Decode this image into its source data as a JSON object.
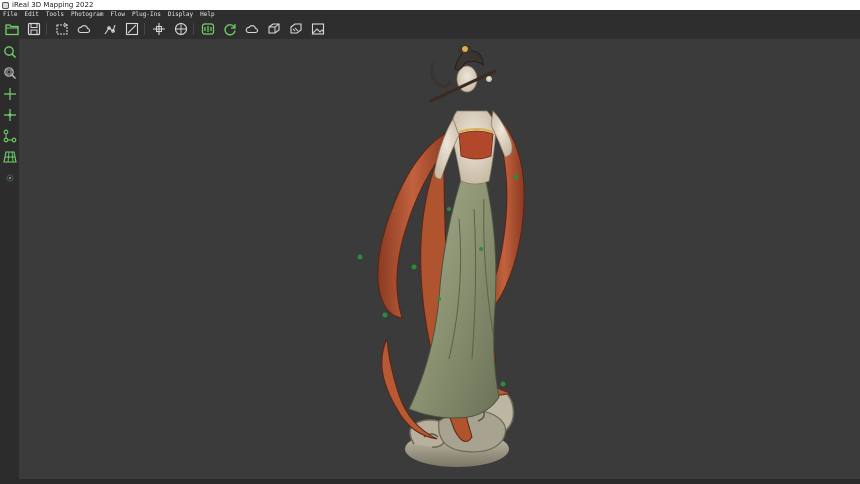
{
  "window": {
    "title": "iReal 3D Mapping 2022"
  },
  "menu": {
    "items": [
      "File",
      "Edit",
      "Tools",
      "Photogram",
      "Flow",
      "Plug-Ins",
      "Display",
      "Help"
    ]
  },
  "toolbar": {
    "buttons": [
      "open-folder-icon",
      "save-icon",
      "import-icon",
      "cloud-icon",
      "mesh-edit-icon",
      "ruler-icon",
      "transform-icon",
      "target-icon",
      "align-icon",
      "refresh-icon",
      "point-cloud-icon",
      "model-icon",
      "texture-icon",
      "image-icon"
    ]
  },
  "left_toolbar": {
    "buttons": [
      "zoom-icon",
      "zoom-fit-icon",
      "crosshair-icon",
      "crosshair-dot-icon",
      "node-graph-icon",
      "grid-icon",
      "record-icon"
    ]
  },
  "colors": {
    "accent_green": "#6fd36a",
    "background": "#3b3b3b",
    "toolbar_bg": "#2e2e2e"
  },
  "viewport": {
    "model": "3D statue model (textured mesh)"
  }
}
